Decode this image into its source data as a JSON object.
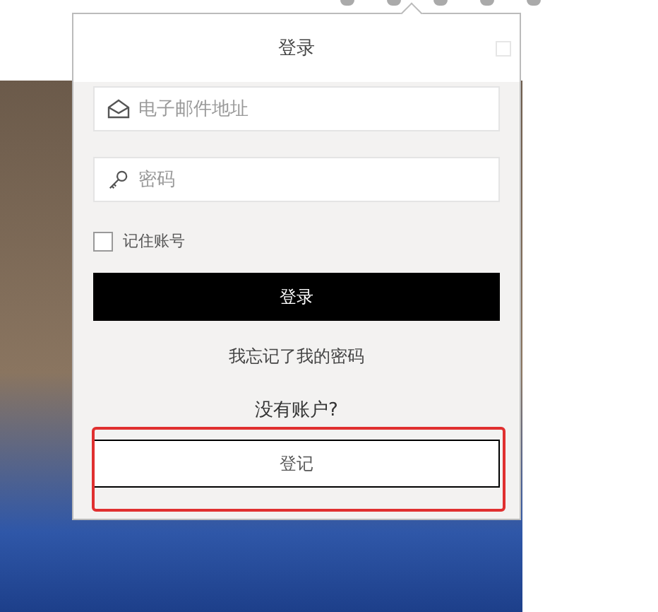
{
  "login_panel": {
    "title": "登录",
    "email_field": {
      "placeholder": "电子邮件地址"
    },
    "password_field": {
      "placeholder": "密码"
    },
    "remember": {
      "label": "记住账号",
      "checked": false
    },
    "login_button": "登录",
    "forgot_link": "我忘记了我的密码",
    "no_account_text": "没有账户?",
    "register_button": "登记"
  }
}
